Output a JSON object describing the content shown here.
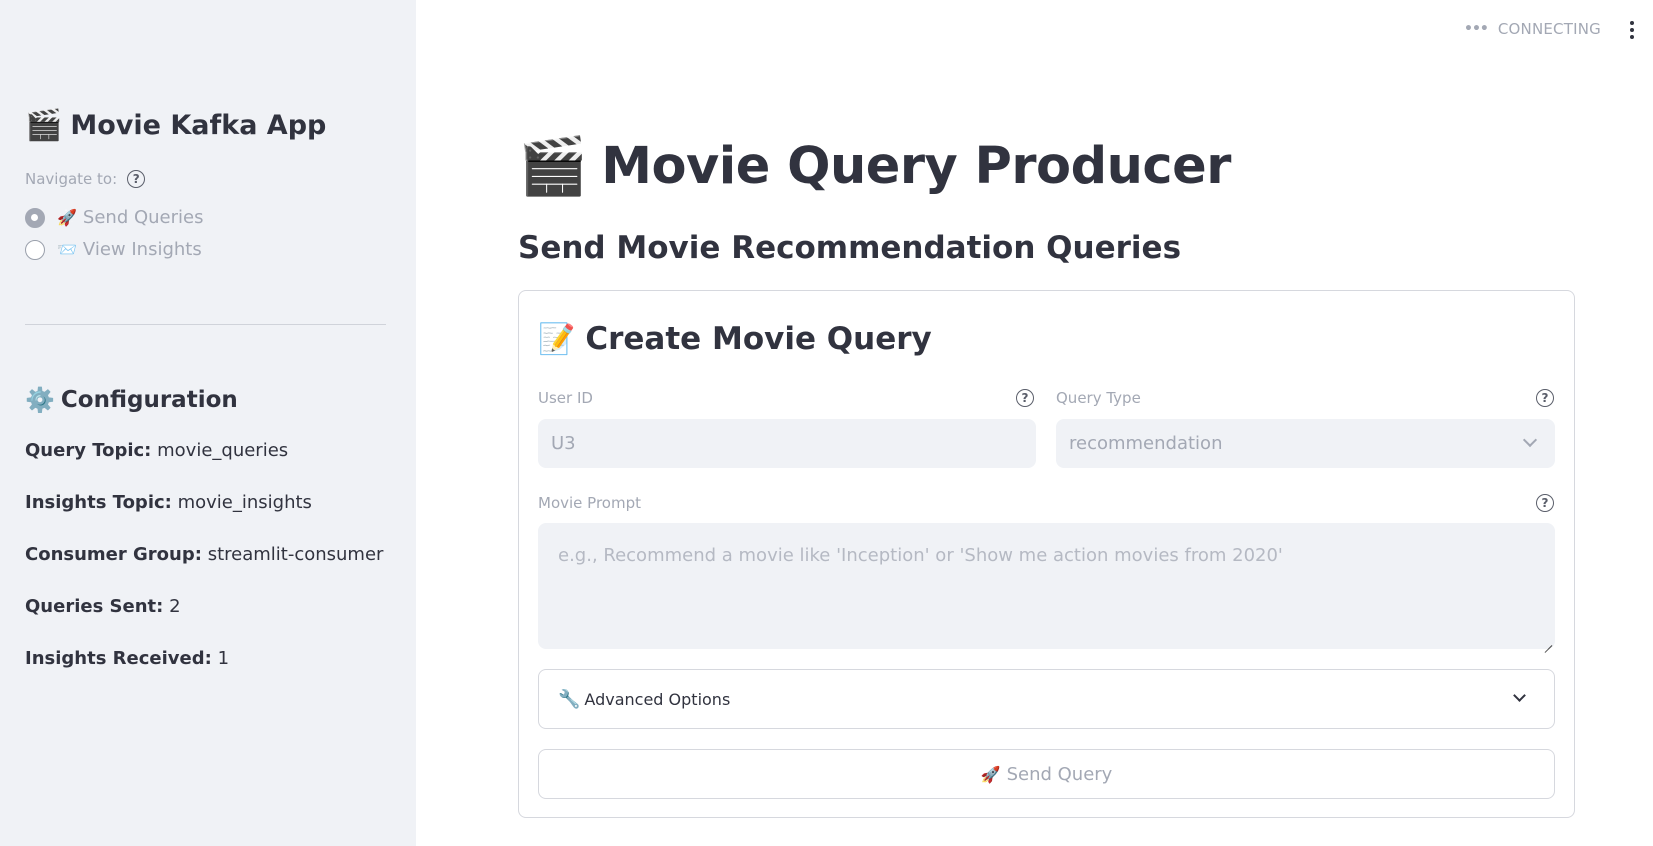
{
  "sidebar": {
    "app_title_emoji": "🎬",
    "app_title": "Movie Kafka App",
    "nav_label": "Navigate to:",
    "nav_help_icon": "question-circle-icon",
    "nav_options": [
      {
        "emoji": "🚀",
        "label": "Send Queries",
        "selected": true
      },
      {
        "emoji": "📨",
        "label": "View Insights",
        "selected": false
      }
    ],
    "config_emoji": "⚙️",
    "config_title": "Configuration",
    "config_items": [
      {
        "key": "Query Topic:",
        "value": "movie_queries"
      },
      {
        "key": "Insights Topic:",
        "value": "movie_insights"
      },
      {
        "key": "Consumer Group:",
        "value": "streamlit-consumer"
      },
      {
        "key": "Queries Sent:",
        "value": "2"
      },
      {
        "key": "Insights Received:",
        "value": "1"
      }
    ]
  },
  "header": {
    "status_dots": "•••",
    "status_text": "CONNECTING",
    "menu_icon": "vertical-ellipsis-icon"
  },
  "main": {
    "title_emoji": "🎬",
    "title": "Movie Query Producer",
    "subtitle": "Send Movie Recommendation Queries",
    "form": {
      "title_emoji": "📝",
      "title": "Create Movie Query",
      "user_id_label": "User ID",
      "user_id_value": "U3",
      "query_type_label": "Query Type",
      "query_type_value": "recommendation",
      "movie_prompt_label": "Movie Prompt",
      "movie_prompt_placeholder": "e.g., Recommend a movie like 'Inception' or 'Show me action movies from 2020'",
      "advanced_emoji": "🔧",
      "advanced_label": "Advanced Options",
      "send_emoji": "🚀",
      "send_label": "Send Query"
    }
  }
}
